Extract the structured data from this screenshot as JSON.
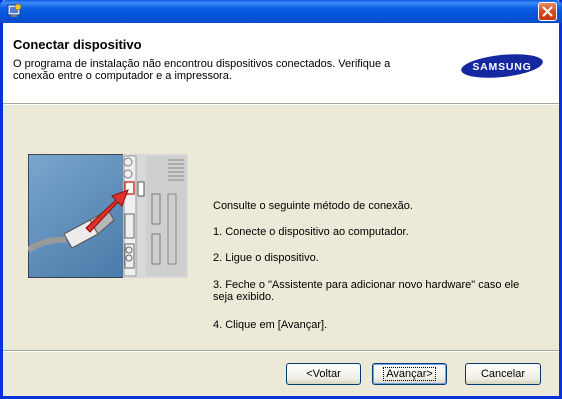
{
  "header": {
    "title": "Conectar dispositivo",
    "description": "O programa de instalação não encontrou dispositivos conectados. Verifique a conexão entre o computador e a impressora.",
    "logo_text": "SAMSUNG"
  },
  "instructions": {
    "intro": "Consulte o seguinte método de conexão.",
    "step1": "1. Conecte o dispositivo ao computador.",
    "step2": "2. Ligue o dispositivo.",
    "step3": "3. Feche o \"Assistente para adicionar novo hardware\" caso ele seja exibido.",
    "step4": "4. Clique em [Avançar]."
  },
  "buttons": {
    "back": "<Voltar",
    "next": "Avançar>",
    "cancel": "Cancelar"
  },
  "colors": {
    "titlebar": "#0653d8",
    "close_button": "#d4481c",
    "samsung_blue": "#1428a0",
    "dialog_bg": "#ece9d8"
  },
  "icons": {
    "app": "installer-icon",
    "close": "close-icon",
    "illustration": "usb-connection-illustration"
  }
}
